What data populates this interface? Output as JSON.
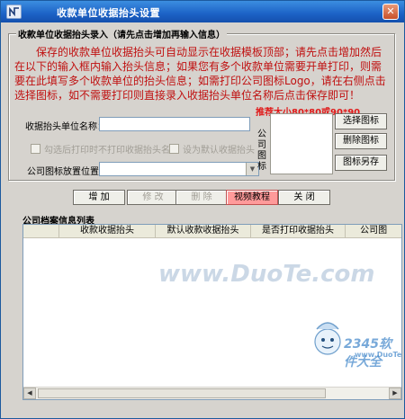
{
  "window": {
    "title": "收款单位收据抬头设置",
    "close_glyph": "✕",
    "icon": "app-icon"
  },
  "entry_group": {
    "label": "收款单位收据抬头录入（请先点击增加再输入信息）",
    "intro": "保存的收款单位收据抬头可自动显示在收据模板顶部；请先点击增加然后在以下的输入框内输入抬头信息；如果您有多个收款单位需要开单打印，则需要在此填写多个收款单位的抬头信息；如需打印公司图标Logo，请在右侧点击选择图标，如不需要打印则直接录入收据抬头单位名称后点击保存即可！",
    "name_label": "收据抬头单位名称：",
    "name_value": "",
    "check_print_company": "勾选后打印时不打印收据抬头名称",
    "check_default": "设为默认收据抬头",
    "position_label": "公司图标放置位置：",
    "position_value": "",
    "logo_vertical_label": "公司图标",
    "recommend": "推荐大小80*80或90*90"
  },
  "side_buttons": {
    "select": "选择图标",
    "delete": "删除图标",
    "save_as": "图标另存"
  },
  "actions": {
    "add": "增 加",
    "edit": "修 改",
    "delete": "删 除",
    "video": "视频教程",
    "close": "关 闭"
  },
  "list": {
    "label": "公司档案信息列表",
    "columns": [
      "",
      "收款收据抬头",
      "默认收款收据抬头",
      "是否打印收据抬头",
      "公司图"
    ]
  },
  "watermarks": {
    "top": "www.DuoTe.com",
    "brand": "2345软件大全",
    "brand_url": "www.DuoTe.com"
  },
  "colors": {
    "titlebar": "#1c62c6",
    "intro_text": "#c01010",
    "recommend_text": "#e01818",
    "video_button": "#ff9a9a"
  }
}
